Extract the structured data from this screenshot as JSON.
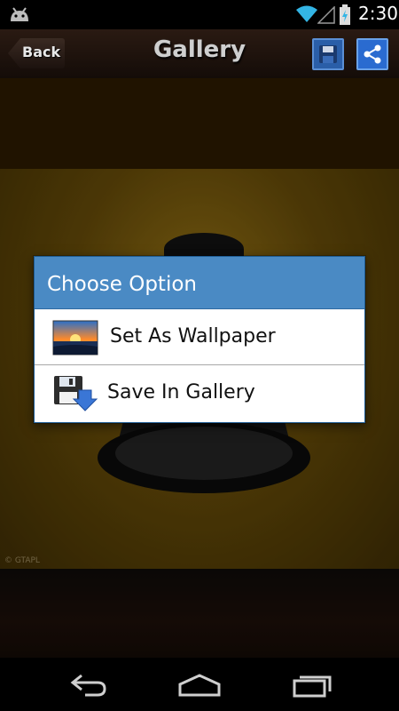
{
  "status_bar": {
    "time": "2:30",
    "icons": [
      "android-icon",
      "wifi-icon",
      "signal-icon",
      "battery-charging-icon"
    ]
  },
  "action_bar": {
    "back_label": "Back",
    "title": "Gallery",
    "icons": [
      "save-icon",
      "share-icon"
    ],
    "colors": {
      "button_blue": "#2a5ea8",
      "header_brown": "#2a1a12"
    }
  },
  "photo": {
    "copyright": "© GTAPL"
  },
  "dialog": {
    "title": "Choose Option",
    "header_color": "#4a8ac4",
    "options": [
      {
        "label": "Set As Wallpaper",
        "icon": "wallpaper-icon"
      },
      {
        "label": "Save In Gallery",
        "icon": "floppy-save-icon"
      }
    ]
  },
  "nav_bar": {
    "icons": [
      "back-icon",
      "home-icon",
      "recent-apps-icon"
    ]
  }
}
